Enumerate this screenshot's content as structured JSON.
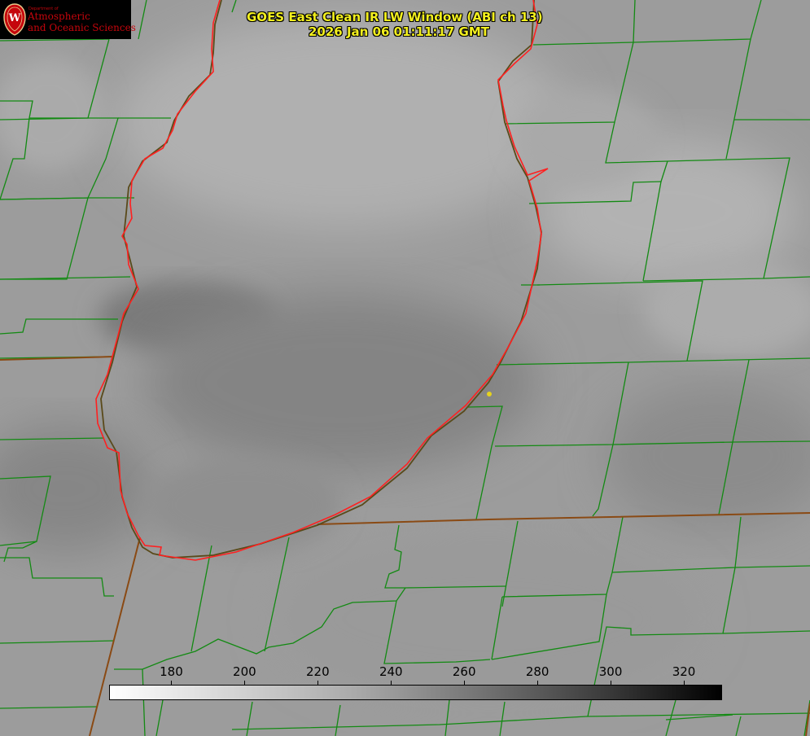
{
  "logo": {
    "dept_label": "Department of",
    "line1": "Atmospheric",
    "line2": "and Oceanic Sciences"
  },
  "title_line1": "GOES East Clean IR LW Window (ABI ch 13)",
  "title_line2": "2026 Jan 06 01:11:17 GMT",
  "colorbar": {
    "ticks": [
      "180",
      "200",
      "220",
      "240",
      "260",
      "280",
      "300",
      "320"
    ],
    "tick_values": [
      180,
      200,
      220,
      240,
      260,
      280,
      300,
      320
    ],
    "range": [
      163,
      330
    ],
    "colormap": "white-to-black"
  },
  "colors": {
    "county_lines": "#138a13",
    "state_lines": "#8a4a14",
    "lakeshore": "#ff2020",
    "title_text": "#f2ef1e",
    "logo_text": "#c5050c"
  }
}
